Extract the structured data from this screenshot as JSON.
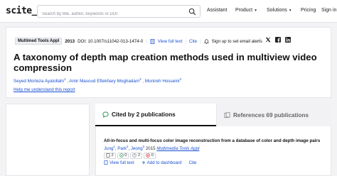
{
  "header": {
    "logo": "scite_",
    "search_placeholder": "Search by title, author, keywords or DOI",
    "nav": [
      {
        "label": "Assistant",
        "has_menu": false
      },
      {
        "label": "Product",
        "has_menu": true
      },
      {
        "label": "Solutions",
        "has_menu": true
      },
      {
        "label": "Pricing",
        "has_menu": false
      },
      {
        "label": "Sign in",
        "has_menu": false
      }
    ]
  },
  "paper": {
    "journal": "Multimed Tools Appl",
    "year": "2013",
    "doi": "DOI: 10.1007/s11042-013-1474-0",
    "view_full_text": "View full text",
    "cite": "Cite",
    "alerts": "Sign up to set email alerts",
    "title": "A taxonomy of depth map creation methods used in multiview video compression",
    "authors": [
      {
        "name": "Seyed Morteza Ayatollahi",
        "sup": "1"
      },
      {
        "name": "Amir Masoud Eftekhary Moghadam",
        "sup": "2"
      },
      {
        "name": "Monireh Hosseini",
        "sup": "3"
      }
    ],
    "understand_link": "Help me understand this report"
  },
  "tabs": {
    "cited_by": "Cited by 2 publications",
    "references": "References 69 publications"
  },
  "result": {
    "title": "All-in-focus and multi-focus color image reconstruction from a database of color and depth image pairs",
    "authors": [
      {
        "name": "Jung",
        "sup": "1"
      },
      {
        "name": "Park",
        "sup": "2"
      },
      {
        "name": "Jeong",
        "sup": "3"
      }
    ],
    "year": "2015",
    "journal": "Multimedia Tools Appl",
    "badges": [
      {
        "icon": "document-icon",
        "count": "2"
      },
      {
        "icon": "check-circle-icon",
        "count": "0",
        "color": "#2b9a53"
      },
      {
        "icon": "question-circle-icon",
        "count": "2",
        "color": "#8a8f98"
      },
      {
        "icon": "x-circle-icon",
        "count": "0",
        "color": "#d1342b"
      }
    ],
    "actions": {
      "view_full_text": "View full text",
      "add_to_dashboard": "Add to dashboard",
      "cite": "Cite"
    }
  },
  "colors": {
    "link": "#1a4fd1",
    "supporting": "#2b9a53",
    "mentioning": "#8a8f98",
    "contrasting": "#d1342b"
  }
}
